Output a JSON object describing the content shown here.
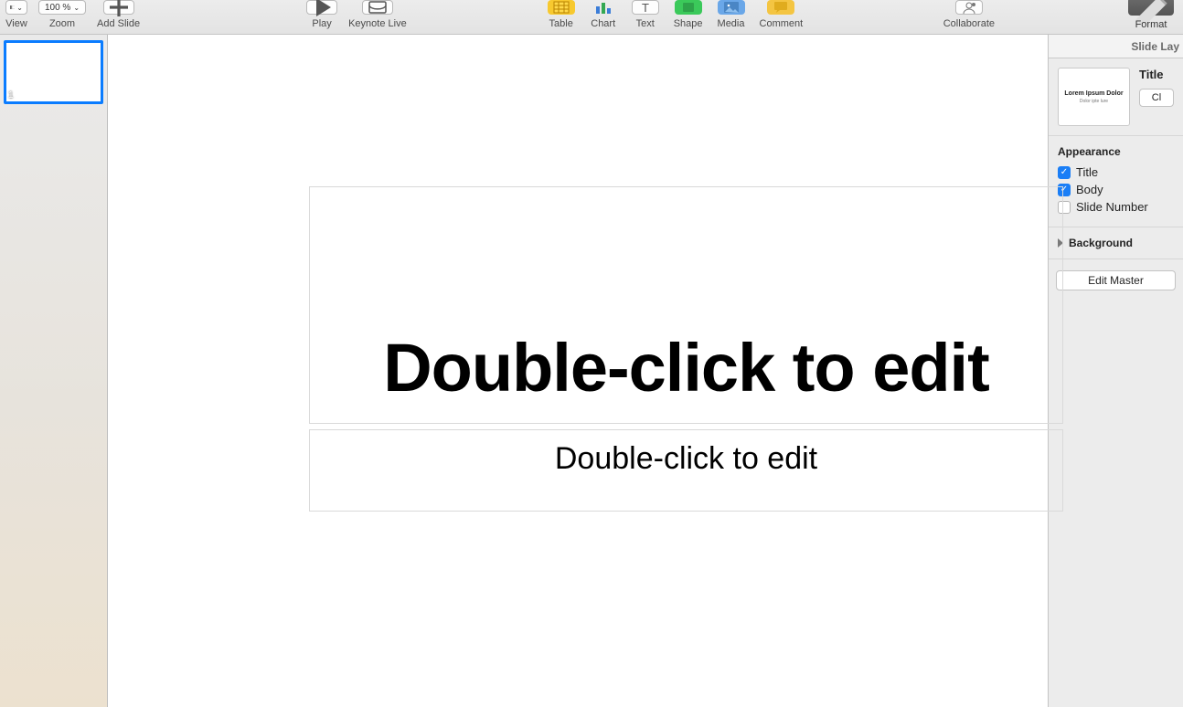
{
  "toolbar": {
    "view_label": "View",
    "zoom_value": "100 %",
    "zoom_label": "Zoom",
    "add_slide_label": "Add Slide",
    "play_label": "Play",
    "keynote_live_label": "Keynote Live",
    "table_label": "Table",
    "chart_label": "Chart",
    "text_label": "Text",
    "shape_label": "Shape",
    "media_label": "Media",
    "comment_label": "Comment",
    "collaborate_label": "Collaborate",
    "format_label": "Format"
  },
  "navigator": {
    "slides": [
      {
        "number": "1"
      }
    ]
  },
  "canvas": {
    "title_placeholder": "Double-click to edit",
    "body_placeholder": "Double-click to edit"
  },
  "inspector": {
    "tab_label": "Slide Lay",
    "master_preview_line1": "Lorem Ipsum Dolor",
    "master_preview_line2": "Dolor ipte lure",
    "master_name": "Title",
    "change_master_label": "Cl",
    "appearance_header": "Appearance",
    "title_toggle_label": "Title",
    "title_toggle_checked": true,
    "body_toggle_label": "Body",
    "body_toggle_checked": true,
    "slide_number_toggle_label": "Slide Number",
    "slide_number_toggle_checked": false,
    "background_label": "Background",
    "edit_master_label": "Edit Master"
  }
}
